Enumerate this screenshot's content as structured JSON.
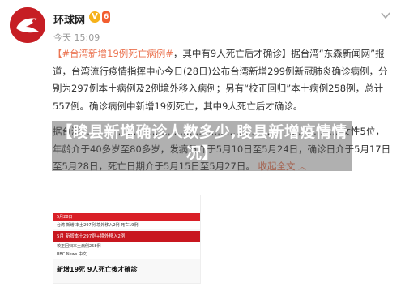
{
  "account": {
    "name": "环球网",
    "verified_mark": "V",
    "level_badge": "6",
    "time": "今天 15:09"
  },
  "post": {
    "hashtag": "【#台湾新增19例死亡病例#",
    "line1_rest": "，其中有9人死亡后才确诊】据台湾“东森新闻网”报",
    "line2": "道，台湾流行疫情指挥中心今日(28日)公布台湾新增299例新冠肺炎确诊病例，分",
    "line3": "别为297例本土病例及2例境外移入病例；另有“校正回归”本土病例258例，总计",
    "line4": "557例。确诊病例中新增19例死亡，其中9人死亡后才确诊。",
    "line5": "据台湾…………………………………………………………………………女性5位，",
    "line6": "年龄介于40多岁至80多岁，发病日介于5月10日至5月24日，确诊日介于5月17日",
    "line7": "至5月28日，死亡日期介于5月15日至5月27日。",
    "expand_label": "收起全文",
    "expand_icon": "chevron-up"
  },
  "headline": {
    "text": "【睃县新增确诊人数多少,睃县新增疫情情况】"
  },
  "thumbnail": {
    "bar_text": "5月28日",
    "bar2_text": "台湾  新增  本土297例  境外移入2例  死亡19例",
    "tab_text": "5月 新增本土297例+境外移入2例",
    "line_text": "校正回归本土病例258例",
    "line2_text": "BBC News 中文",
    "title": "新增19死 9人死亡後才確診"
  },
  "colors": {
    "brand": "#c61e24",
    "link": "#eb7350"
  }
}
